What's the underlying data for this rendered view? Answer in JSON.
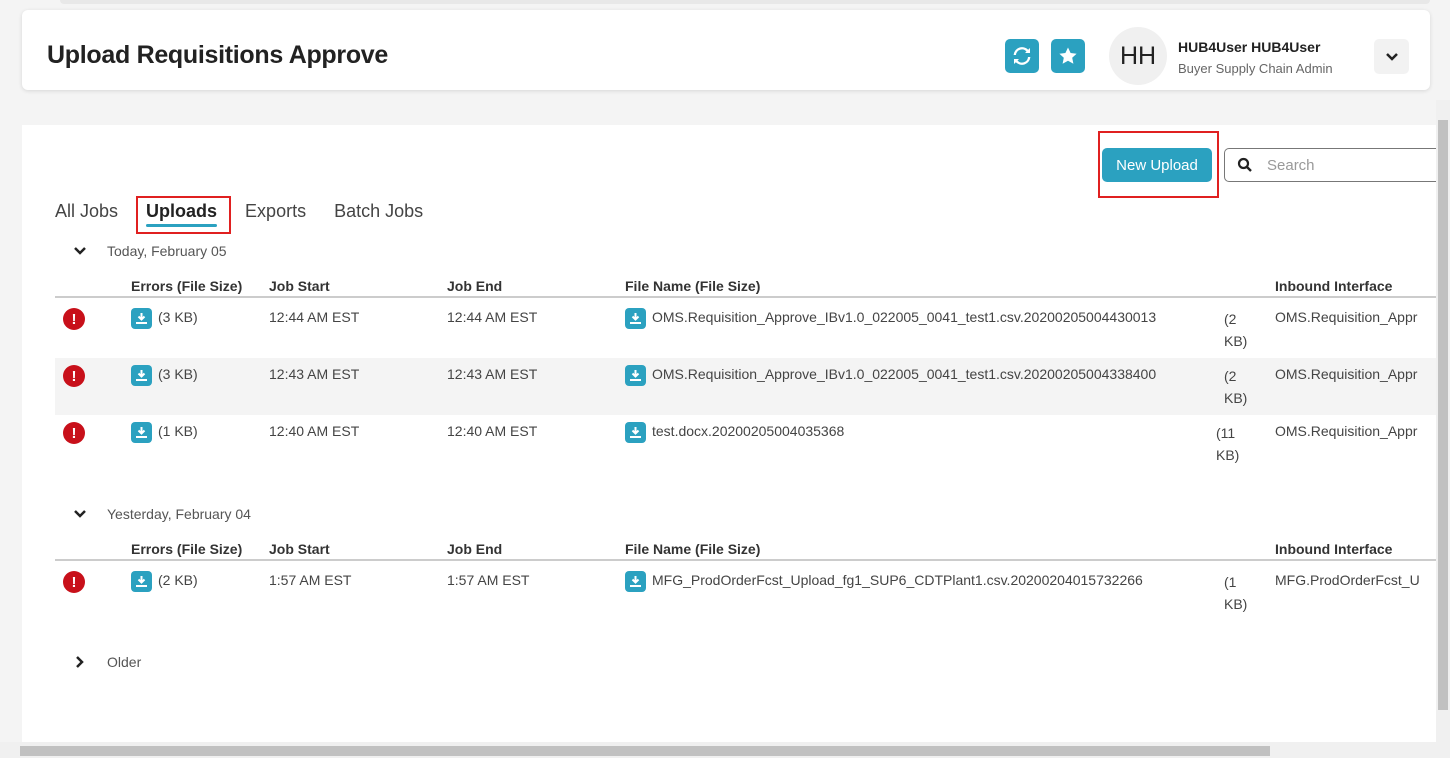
{
  "header": {
    "title": "Upload Requisitions Approve",
    "avatar_initials": "HH",
    "user_name": "HUB4User HUB4User",
    "user_role": "Buyer Supply Chain Admin"
  },
  "toolbar": {
    "new_upload_label": "New Upload",
    "search_placeholder": "Search"
  },
  "tabs": [
    {
      "label": "All Jobs"
    },
    {
      "label": "Uploads",
      "active": true
    },
    {
      "label": "Exports"
    },
    {
      "label": "Batch Jobs"
    }
  ],
  "columns": [
    "Errors (File Size)",
    "Job Start",
    "Job End",
    "File Name (File Size)",
    "Inbound Interface"
  ],
  "groups": [
    {
      "label": "Today, February 05",
      "rows": [
        {
          "error_size": "(3 KB)",
          "start": "12:44 AM EST",
          "end": "12:44 AM EST",
          "file": "OMS.Requisition_Approve_IBv1.0_022005_0041_test1.csv.20200205004430013",
          "size1": "(2",
          "size2": "KB)",
          "interface": "OMS.Requisition_Appr"
        },
        {
          "error_size": "(3 KB)",
          "start": "12:43 AM EST",
          "end": "12:43 AM EST",
          "file": "OMS.Requisition_Approve_IBv1.0_022005_0041_test1.csv.20200205004338400",
          "size1": "(2",
          "size2": "KB)",
          "interface": "OMS.Requisition_Appr"
        },
        {
          "error_size": "(1 KB)",
          "start": "12:40 AM EST",
          "end": "12:40 AM EST",
          "file": "test.docx.20200205004035368",
          "size1": "(11",
          "size2": "KB)",
          "interface": "OMS.Requisition_Appr"
        }
      ]
    },
    {
      "label": "Yesterday, February 04",
      "rows": [
        {
          "error_size": "(2 KB)",
          "start": "1:57 AM EST",
          "end": "1:57 AM EST",
          "file": "MFG_ProdOrderFcst_Upload_fg1_SUP6_CDTPlant1.csv.20200204015732266",
          "size1": "(1",
          "size2": "KB)",
          "interface": "MFG.ProdOrderFcst_U"
        }
      ]
    },
    {
      "label": "Older",
      "rows": []
    }
  ],
  "colors": {
    "accent": "#2ba1c0",
    "error": "#c8101a",
    "highlight": "#e02020"
  }
}
